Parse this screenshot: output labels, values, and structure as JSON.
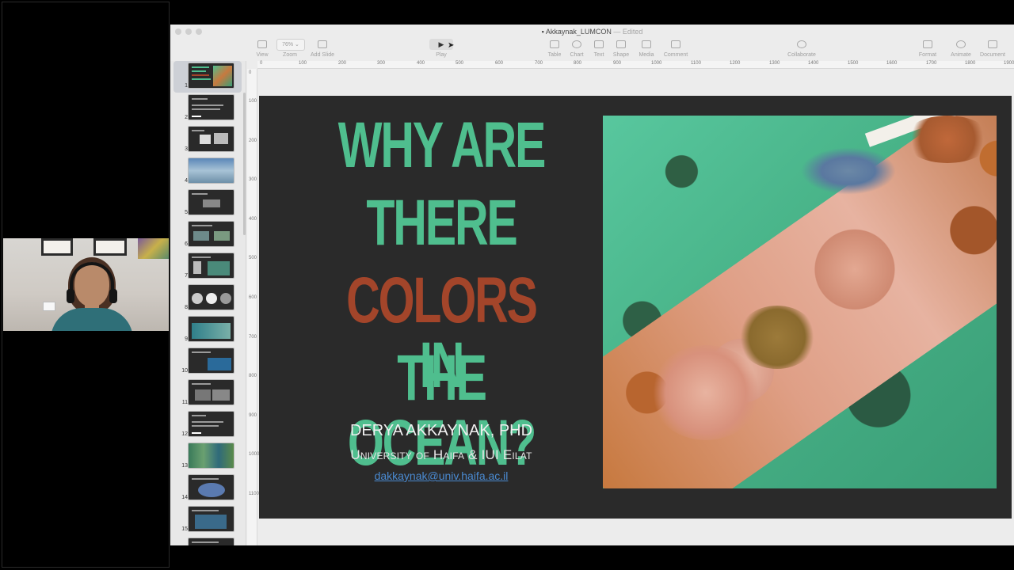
{
  "window": {
    "title": "Akkaynak_LUMCON",
    "status": "Edited"
  },
  "toolbar": {
    "zoom_value": "76%",
    "items": [
      {
        "label": "View",
        "icon": "sidebar-icon"
      },
      {
        "label": "Zoom",
        "icon": "zoom-icon"
      },
      {
        "label": "Add Slide",
        "icon": "add-slide-icon"
      },
      {
        "label": "Play",
        "icon": "play-icon"
      },
      {
        "label": "Table",
        "icon": "table-icon"
      },
      {
        "label": "Chart",
        "icon": "chart-icon"
      },
      {
        "label": "Text",
        "icon": "text-icon"
      },
      {
        "label": "Shape",
        "icon": "shape-icon"
      },
      {
        "label": "Media",
        "icon": "media-icon"
      },
      {
        "label": "Comment",
        "icon": "comment-icon"
      },
      {
        "label": "Collaborate",
        "icon": "collaborate-icon"
      },
      {
        "label": "Format",
        "icon": "format-icon"
      },
      {
        "label": "Animate",
        "icon": "animate-icon"
      },
      {
        "label": "Document",
        "icon": "document-icon"
      }
    ]
  },
  "navigator": {
    "slide_numbers": [
      "1",
      "2",
      "3",
      "4",
      "5",
      "6",
      "7",
      "8",
      "9",
      "10",
      "11",
      "12",
      "13",
      "14",
      "15"
    ],
    "selected_slide": "1"
  },
  "ruler": {
    "horizontal_ticks": [
      "0",
      "100",
      "200",
      "300",
      "400",
      "500",
      "600",
      "700",
      "800",
      "900",
      "1000",
      "1100",
      "1200",
      "1300",
      "1400",
      "1500",
      "1600",
      "1700",
      "1800",
      "1900"
    ],
    "vertical_ticks": [
      "0",
      "100",
      "200",
      "300",
      "400",
      "500",
      "600",
      "700",
      "800",
      "900",
      "1000",
      "1100"
    ]
  },
  "slide": {
    "title_lines": [
      "WHY ARE",
      "THERE",
      "COLORS IN",
      "THE OCEAN?"
    ],
    "title_highlight": "COLORS",
    "title_rest_line3": " IN",
    "speaker": "DERYA AKKAYNAK, PHD",
    "affiliation": "University of Haifa & IUI Eilat",
    "email": "dakkaynak@univ.haifa.ac.il"
  },
  "colors": {
    "title_green": "#4fbe8e",
    "title_rust": "#a3452a",
    "slide_background": "#2a2a2a",
    "link_blue": "#4a8ad1"
  }
}
